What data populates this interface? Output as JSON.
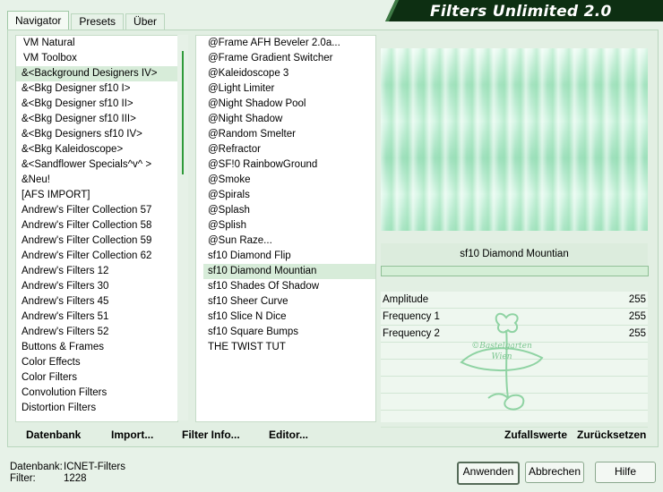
{
  "tabs": [
    {
      "label": "Navigator"
    },
    {
      "label": "Presets"
    },
    {
      "label": "Über"
    }
  ],
  "title": "Filters Unlimited 2.0",
  "categories": [
    "VM Natural",
    "VM Toolbox",
    "&<Background Designers IV>",
    "&<Bkg Designer sf10 I>",
    "&<Bkg Designer sf10 II>",
    "&<Bkg Designer sf10 III>",
    "&<Bkg Designers sf10 IV>",
    "&<Bkg Kaleidoscope>",
    "&<Sandflower Specials^v^ >",
    "&Neu!",
    "[AFS IMPORT]",
    "Andrew's Filter Collection 57",
    "Andrew's Filter Collection 58",
    "Andrew's Filter Collection 59",
    "Andrew's Filter Collection 62",
    "Andrew's Filters 12",
    "Andrew's Filters 30",
    "Andrew's Filters 45",
    "Andrew's Filters 51",
    "Andrew's Filters 52",
    "Buttons & Frames",
    "Color Effects",
    "Color Filters",
    "Convolution Filters",
    "Distortion Filters"
  ],
  "selected_category_index": 2,
  "filters": [
    "@Frame AFH Beveler 2.0a...",
    "@Frame Gradient Switcher",
    "@Kaleidoscope 3",
    "@Light Limiter",
    "@Night Shadow Pool",
    "@Night Shadow",
    "@Random Smelter",
    "@Refractor",
    "@SF!0 RainbowGround",
    "@Smoke",
    "@Spirals",
    "@Splash",
    "@Splish",
    "@Sun Raze...",
    "sf10 Diamond Flip",
    "sf10 Diamond Mountian",
    "sf10 Shades Of Shadow",
    "sf10 Sheer Curve",
    "sf10 Slice N Dice",
    "sf10 Square Bumps",
    "THE TWIST TUT"
  ],
  "selected_filter_index": 15,
  "preview_label": "sf10 Diamond Mountian",
  "params": [
    {
      "name": "Amplitude",
      "value": "255"
    },
    {
      "name": "Frequency 1",
      "value": "255"
    },
    {
      "name": "Frequency 2",
      "value": "255"
    },
    {
      "name": "",
      "value": ""
    },
    {
      "name": "",
      "value": ""
    },
    {
      "name": "",
      "value": ""
    },
    {
      "name": "",
      "value": ""
    },
    {
      "name": "",
      "value": ""
    }
  ],
  "watermark": {
    "line1": "©Bastelgarten",
    "line2": "Wien"
  },
  "bottom_links": {
    "database": "Datenbank",
    "import": "Import...",
    "filter_info": "Filter Info...",
    "editor": "Editor...",
    "random": "Zufallswerte",
    "reset": "Zurücksetzen"
  },
  "status": {
    "db_label": "Datenbank:",
    "db_value": "ICNET-Filters",
    "filter_label": "Filter:",
    "filter_value": "1228"
  },
  "buttons": {
    "apply": "Anwenden",
    "cancel": "Abbrechen",
    "help": "Hilfe"
  },
  "colors": {
    "accent": "#2f9a3a",
    "title_bg": "#0d2f12",
    "selection": "#d7ecd9",
    "window_bg": "#e7f2e8"
  }
}
